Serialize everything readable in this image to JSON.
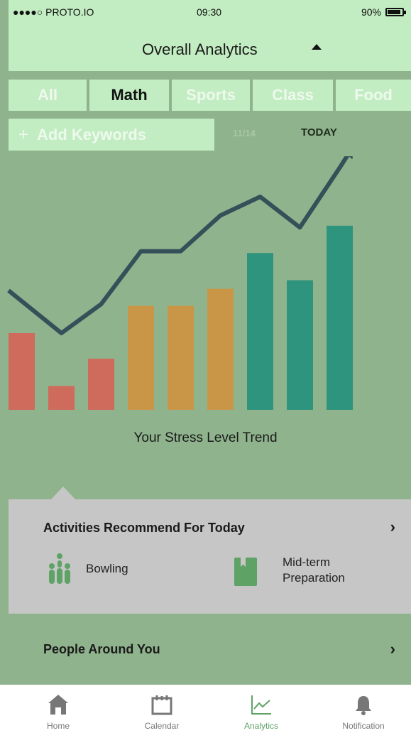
{
  "status_bar": {
    "carrier": "●●●●○ PROTO.IO",
    "time": "09:30",
    "battery": "90%"
  },
  "header": {
    "title": "Overall Analytics"
  },
  "tabs": [
    {
      "label": "All",
      "active": false
    },
    {
      "label": "Math",
      "active": true
    },
    {
      "label": "Sports",
      "active": false
    },
    {
      "label": "Class",
      "active": false
    },
    {
      "label": "Food",
      "active": false
    }
  ],
  "add_keywords": {
    "plus": "+",
    "label": "Add Keywords"
  },
  "date_range": {
    "date": "11/14",
    "today": "TODAY"
  },
  "chart_data": {
    "type": "bar",
    "title": "Your Stress Level Trend",
    "values": [
      45,
      14,
      30,
      61,
      61,
      71,
      92,
      76,
      108
    ],
    "colors": [
      "#cf6b5c",
      "#cf6b5c",
      "#cf6b5c",
      "#c99648",
      "#c99648",
      "#c99648",
      "#2f947d",
      "#2f947d",
      "#2f947d"
    ],
    "trend_line": [
      70,
      45,
      62,
      93,
      93,
      114,
      125,
      107,
      142
    ],
    "trend_color": "#36505a",
    "ylim": [
      0,
      148
    ]
  },
  "recommendations": {
    "title": "Activities Recommend For Today",
    "chevron": "›",
    "items": [
      {
        "icon": "bowling-icon",
        "label": "Bowling"
      },
      {
        "icon": "book-icon",
        "label": "Mid-term Preparation"
      }
    ]
  },
  "people": {
    "title": "People Around You",
    "chevron": "›"
  },
  "nav": [
    {
      "icon": "home-icon",
      "label": "Home",
      "active": false
    },
    {
      "icon": "calendar-icon",
      "label": "Calendar",
      "active": false
    },
    {
      "icon": "analytics-icon",
      "label": "Analytics",
      "active": true
    },
    {
      "icon": "bell-icon",
      "label": "Notification",
      "active": false
    }
  ],
  "colors": {
    "panel_light": "#c2ecc1",
    "background": "#8fb38c",
    "accent": "#5ea266",
    "recommend_bg": "#c6c6c6"
  }
}
